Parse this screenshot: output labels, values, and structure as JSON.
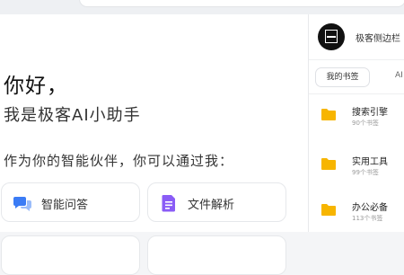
{
  "main": {
    "greeting": "你好，",
    "subgreeting": "我是极客AI小助手",
    "intro": "作为你的智能伙伴，你可以通过我：",
    "cards": [
      {
        "label": "智能问答",
        "icon": "chat-bubbles-icon"
      },
      {
        "label": "文件解析",
        "icon": "document-icon"
      }
    ]
  },
  "sidebar": {
    "title": "极客侧边栏",
    "tabs": [
      {
        "label": "我的书签"
      },
      {
        "label": "AI"
      }
    ],
    "bookmarks": [
      {
        "name": "搜索引擎",
        "count": "90个书签"
      },
      {
        "name": "实用工具",
        "count": "99个书签"
      },
      {
        "name": "办公必备",
        "count": "113个书签"
      }
    ]
  },
  "colors": {
    "folder": "#f7b500",
    "chat_icon": "#3b7cf5",
    "doc_icon": "#8a5cf6"
  }
}
